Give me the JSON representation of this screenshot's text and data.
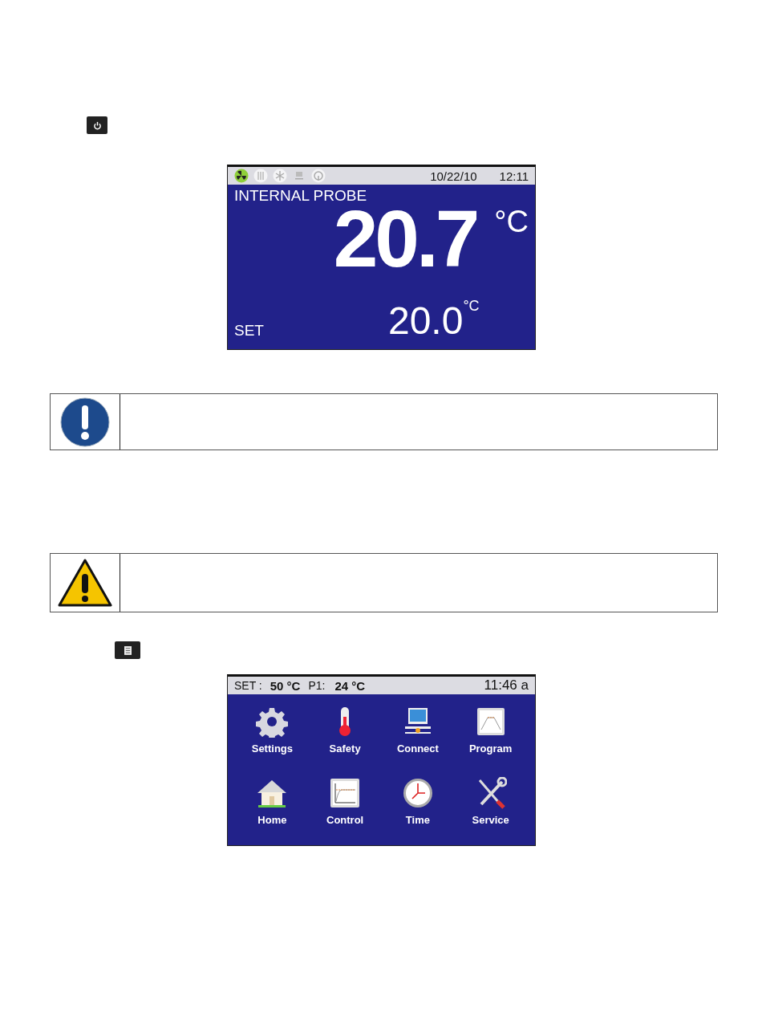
{
  "home_screen": {
    "status_icons": [
      {
        "kind": "fan",
        "active": true
      },
      {
        "kind": "heater",
        "active": false
      },
      {
        "kind": "cooling",
        "active": false
      },
      {
        "kind": "computer",
        "active": false
      },
      {
        "kind": "alarm",
        "active": false
      }
    ],
    "date": "10/22/10",
    "time": "12:11",
    "probe_label": "INTERNAL PROBE",
    "temperature": "20.7",
    "temperature_unit": "°C",
    "set_label": "SET",
    "set_value": "20.0",
    "set_unit": "°C"
  },
  "menu_screen": {
    "set_label": "SET :",
    "set_value": "50 °C",
    "p1_label": "P1:",
    "p1_value": "24 °C",
    "time": "11:46 a",
    "items": [
      {
        "kind": "settings",
        "label": "Settings"
      },
      {
        "kind": "safety",
        "label": "Safety"
      },
      {
        "kind": "connect",
        "label": "Connect"
      },
      {
        "kind": "program",
        "label": "Program"
      },
      {
        "kind": "home",
        "label": "Home"
      },
      {
        "kind": "control",
        "label": "Control"
      },
      {
        "kind": "time",
        "label": "Time"
      },
      {
        "kind": "service",
        "label": "Service"
      }
    ]
  },
  "notices": [
    {
      "kind": "mandatory"
    },
    {
      "kind": "warning"
    }
  ]
}
